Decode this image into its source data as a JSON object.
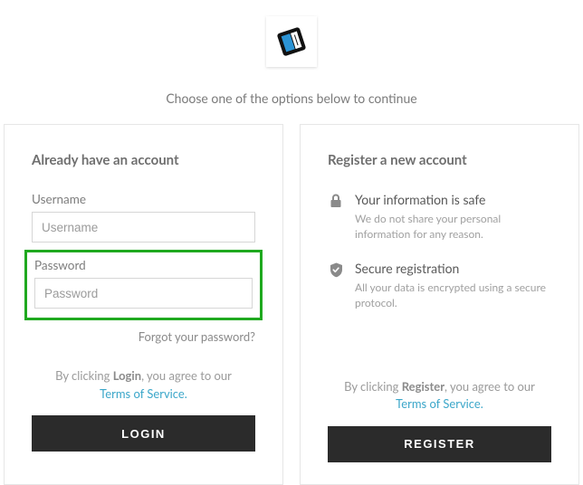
{
  "tagline": "Choose one of the options below to continue",
  "login": {
    "heading": "Already have an account",
    "username_label": "Username",
    "username_placeholder": "Username",
    "username_value": "",
    "password_label": "Password",
    "password_placeholder": "Password",
    "password_value": "",
    "forgot": "Forgot your password?",
    "agree_pre": "By clicking ",
    "agree_strong": "Login",
    "agree_post": ", you agree to our",
    "tos": "Terms of Service.",
    "button": "LOGIN"
  },
  "register": {
    "heading": "Register a new account",
    "info1_title": "Your information is safe",
    "info1_body": "We do not share your personal information for any reason.",
    "info2_title": "Secure registration",
    "info2_body": "All your data is encrypted using a secure protocol.",
    "agree_pre": "By clicking ",
    "agree_strong": "Register",
    "agree_post": ", you agree to our",
    "tos": "Terms of Service.",
    "button": "REGISTER"
  }
}
